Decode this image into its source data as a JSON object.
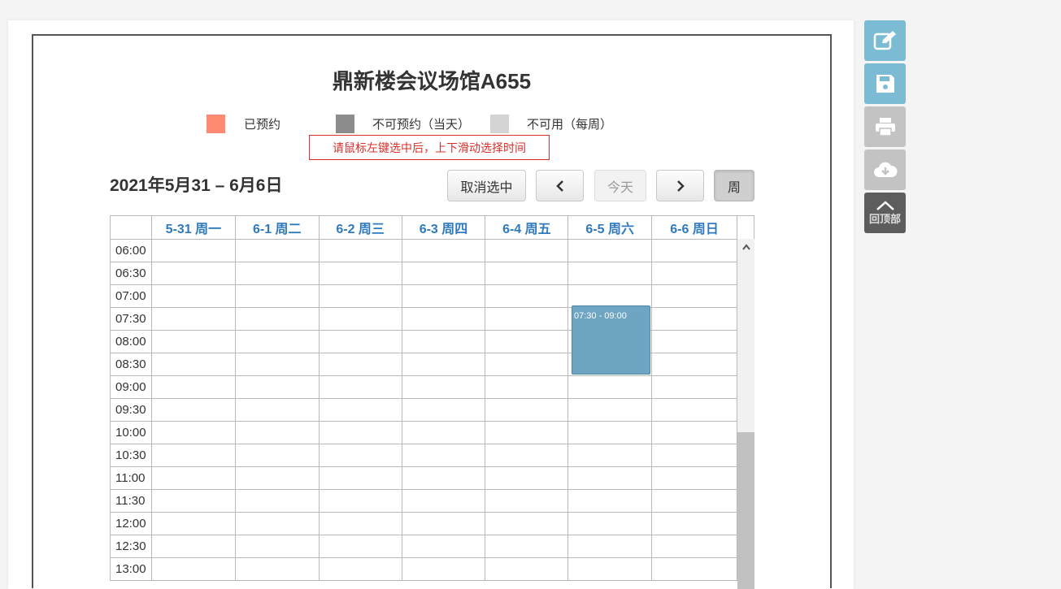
{
  "title": "鼎新楼会议场馆A655",
  "legend": [
    {
      "label": "已预约",
      "color": "#ff8a73"
    },
    {
      "label": "不可预约（当天）",
      "color": "#8c8c8c"
    },
    {
      "label": "不可用（每周）",
      "color": "#d4d4d4"
    }
  ],
  "tip": "请鼠标左键选中后，上下滑动选择时间",
  "toolbar": {
    "range": "2021年5月31 – 6月6日",
    "cancel_label": "取消选中",
    "prev_icon": "chevron-left-icon",
    "today_label": "今天",
    "next_icon": "chevron-right-icon",
    "week_label": "周"
  },
  "days": [
    "5-31 周一",
    "6-1 周二",
    "6-2 周三",
    "6-3 周四",
    "6-4 周五",
    "6-5 周六",
    "6-6 周日"
  ],
  "times": [
    "06:00",
    "06:30",
    "07:00",
    "07:30",
    "08:00",
    "08:30",
    "09:00",
    "09:30",
    "10:00",
    "10:30",
    "11:00",
    "11:30",
    "12:00",
    "12:30",
    "13:00"
  ],
  "event": {
    "label": "07:30 - 09:00",
    "day": "6-5 周六",
    "color": "#6da5c3"
  },
  "side": {
    "edit_icon": "edit-icon",
    "save_icon": "save-icon",
    "print_icon": "print-icon",
    "download_icon": "cloud-download-icon",
    "top_label": "回顶部"
  },
  "colors": {
    "accent": "#7bbbd4",
    "header_text": "#2f7abf",
    "tip": "#d9302d"
  }
}
